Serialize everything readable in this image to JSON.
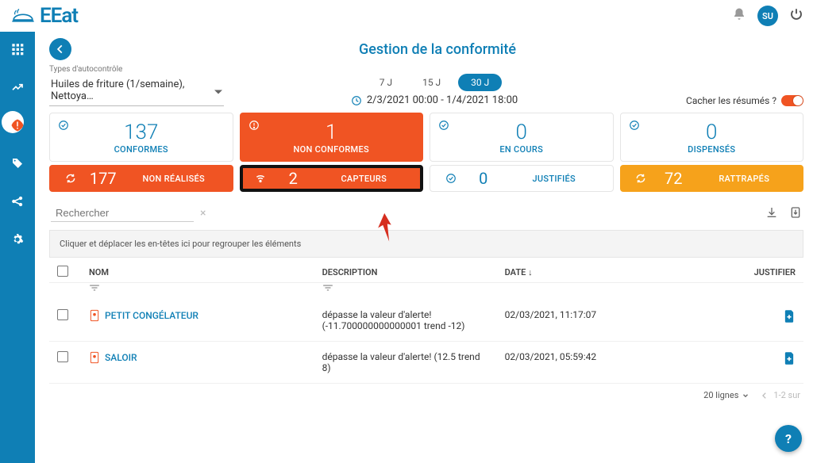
{
  "brand": "EEat",
  "header": {
    "avatar": "SU",
    "title": "Gestion de la conformité"
  },
  "filters": {
    "type_label": "Types d'autocontrôle",
    "type_value": "Huiles de friture (1/semaine), Nettoya…",
    "range_buttons": [
      "7 J",
      "15 J",
      "30 J"
    ],
    "range_selected_index": 2,
    "date_range": "2/3/2021 00:00 - 1/4/2021 18:00",
    "hide_summaries_label": "Cacher les résumés ?"
  },
  "cards": {
    "conformes": {
      "value": "137",
      "label": "CONFORMES"
    },
    "non_conformes": {
      "value": "1",
      "label": "NON CONFORMES"
    },
    "en_cours": {
      "value": "0",
      "label": "EN COURS"
    },
    "dispenses": {
      "value": "0",
      "label": "DISPENSÉS"
    },
    "non_realises": {
      "value": "177",
      "label": "NON RÉALISÉS"
    },
    "capteurs": {
      "value": "2",
      "label": "CAPTEURS"
    },
    "justifies": {
      "value": "0",
      "label": "JUSTIFIÉS"
    },
    "rattrapes": {
      "value": "72",
      "label": "RATTRAPÉS"
    }
  },
  "search": {
    "placeholder": "Rechercher"
  },
  "group_hint": "Cliquer et déplacer les en-têtes ici pour regrouper les éléments",
  "table": {
    "headers": {
      "nom": "NOM",
      "description": "DESCRIPTION",
      "date": "DATE",
      "justifier": "JUSTIFIER"
    },
    "rows": [
      {
        "nom": "PETIT CONGÉLATEUR",
        "description": "dépasse la valeur d'alerte! (-11.700000000000001 trend -12)",
        "date": "02/03/2021, 11:17:07"
      },
      {
        "nom": "SALOIR",
        "description": "dépasse la valeur d'alerte! (12.5 trend 8)",
        "date": "02/03/2021, 05:59:42"
      }
    ]
  },
  "footer": {
    "lines_label": "20 lignes",
    "pager_label": "1-2 sur"
  }
}
